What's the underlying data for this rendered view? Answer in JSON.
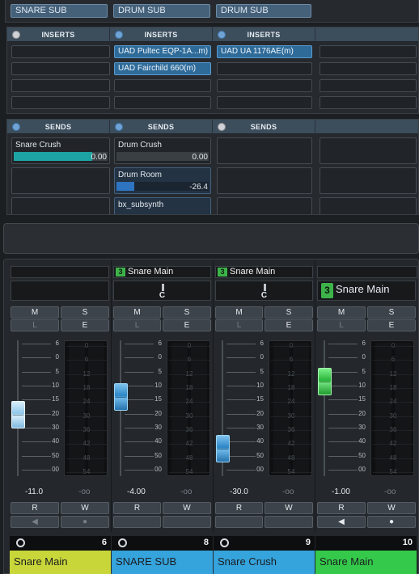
{
  "outputs": [
    "SNARE SUB",
    "DRUM SUB",
    "DRUM SUB"
  ],
  "inserts": {
    "header": "INSERTS",
    "slots": [
      [
        "",
        "UAD Pultec EQP-1A...m)",
        "UAD UA 1176AE(m)"
      ],
      [
        "",
        "UAD Fairchild 660(m)",
        ""
      ],
      [
        "",
        "",
        ""
      ],
      [
        "",
        "",
        ""
      ]
    ]
  },
  "sends": {
    "header": "SENDS",
    "items": [
      {
        "name": "Snare Crush",
        "value": "0.00",
        "fill": 0.84,
        "color": "#1ea3a3"
      },
      {
        "name": "Drum Crush",
        "value": "0.00",
        "fill": 0.82,
        "color": "#3a3f44"
      },
      {
        "name": "Drum Room",
        "value": "-26.4",
        "fill": 0.19,
        "color": "#2f74c0"
      },
      {
        "name": "bx_subsynth",
        "value": "",
        "fill": 0,
        "color": "#2f74c0"
      }
    ]
  },
  "mixer": {
    "channels": [
      {
        "badge": "",
        "input": "",
        "pan": "",
        "vol": "-11.0",
        "peak": "-oo",
        "mute": "M",
        "solo": "S",
        "listen": "L",
        "edit": "E",
        "read": "R",
        "write": "W",
        "num": "6",
        "name": "Snare Main",
        "color": "#c8d63a",
        "level": 0.43,
        "cap": "light"
      },
      {
        "badge": "3",
        "input": "Snare Main",
        "pan": "C",
        "vol": "-4.00",
        "peak": "-oo",
        "mute": "M",
        "solo": "S",
        "listen": "L",
        "edit": "E",
        "read": "R",
        "write": "W",
        "num": "8",
        "name": "SNARE SUB",
        "color": "#35a3dc",
        "level": 0.6,
        "cap": "blue"
      },
      {
        "badge": "3",
        "input": "Snare Main",
        "pan": "C",
        "vol": "-30.0",
        "peak": "-oo",
        "mute": "M",
        "solo": "S",
        "listen": "L",
        "edit": "E",
        "read": "R",
        "write": "W",
        "num": "9",
        "name": "Snare Crush",
        "color": "#35a3dc",
        "level": 0.1,
        "cap": "blue"
      },
      {
        "badge": "3",
        "input": "Snare Main",
        "pan": "",
        "vol": "-1.00",
        "peak": "-oo",
        "mute": "M",
        "solo": "S",
        "listen": "L",
        "edit": "E",
        "read": "R",
        "write": "W",
        "num": "10",
        "name": "Snare Main",
        "color": "#34c94a",
        "level": 0.75,
        "cap": "green"
      }
    ],
    "fader_scale": [
      "6",
      "0",
      "5",
      "10",
      "15",
      "20",
      "30",
      "40",
      "50",
      "00"
    ],
    "meter_scale": [
      "0",
      "6",
      "12",
      "18",
      "24",
      "30",
      "36",
      "42",
      "48",
      "54"
    ]
  }
}
